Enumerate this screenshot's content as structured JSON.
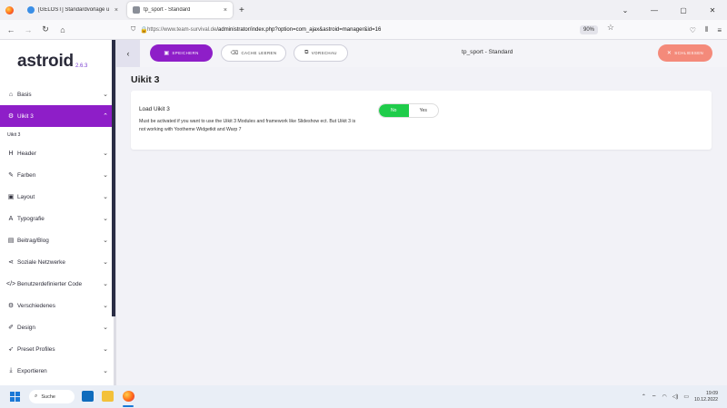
{
  "browser": {
    "tabs": [
      {
        "title": "[GELÖST] Standardvorlage u",
        "close": "×",
        "active": false
      },
      {
        "title": "tp_sport - Standard",
        "close": "×",
        "active": true
      }
    ],
    "new_tab": "+",
    "window_controls": [
      "⌄",
      "—",
      "▢",
      "✕"
    ],
    "url_host": "https://www.team-survival.de",
    "url_path": "/administrator/index.php?option=com_ajax&astroid=manager&id=16",
    "zoom": "90%"
  },
  "sidebar": {
    "logo": "astroid",
    "version": "2.6.3",
    "items": [
      {
        "label": "Basis",
        "icon": "home-icon",
        "glyph": "⌂",
        "active": false
      },
      {
        "label": "Uikit 3",
        "icon": "settings-icon",
        "glyph": "⚙",
        "active": true,
        "expanded": true
      },
      {
        "label": "Header",
        "icon": "heading-icon",
        "glyph": "H",
        "active": false
      },
      {
        "label": "Farben",
        "icon": "brush-icon",
        "glyph": "✎",
        "active": false
      },
      {
        "label": "Layout",
        "icon": "layout-icon",
        "glyph": "▣",
        "active": false
      },
      {
        "label": "Typografie",
        "icon": "font-icon",
        "glyph": "A",
        "active": false
      },
      {
        "label": "Beitrag/Blog",
        "icon": "newspaper-icon",
        "glyph": "▤",
        "active": false
      },
      {
        "label": "Soziale Netzwerke",
        "icon": "share-icon",
        "glyph": "⋖",
        "active": false
      },
      {
        "label": "Benutzerdefinierter Code",
        "icon": "code-icon",
        "glyph": "</>",
        "active": false
      },
      {
        "label": "Verschiedenes",
        "icon": "cogs-icon",
        "glyph": "⚙",
        "active": false
      },
      {
        "label": "Design",
        "icon": "paint-icon",
        "glyph": "✐",
        "active": false
      },
      {
        "label": "Preset Profiles",
        "icon": "rocket-icon",
        "glyph": "➶",
        "active": false
      },
      {
        "label": "Exportieren",
        "icon": "download-icon",
        "glyph": "⤓",
        "active": false
      }
    ],
    "subitem": "Uikit 3"
  },
  "toolbar": {
    "back": "‹",
    "save_label": "Speichern",
    "cache_label": "Cache leeren",
    "preview_label": "Vorschau",
    "page_heading": "tp_sport - Standard",
    "close_label": "Schließen"
  },
  "content": {
    "section_title": "Uikit 3",
    "field_label": "Load Uikit 3",
    "field_desc": "Must be activated if you want to use the Uikit 3 Modules and framework like Slideshow ect. But Uikit 3 is not working with Yootheme Widgetkit and Warp 7",
    "toggle": {
      "no": "No",
      "yes": "Yes",
      "selected": "No"
    }
  },
  "taskbar": {
    "search": "Suche",
    "time": "19:09",
    "date": "10.12.2022"
  },
  "colors": {
    "accent": "#8e1ec8",
    "toggle_on": "#1fcc4a",
    "close": "#f48a7a"
  }
}
